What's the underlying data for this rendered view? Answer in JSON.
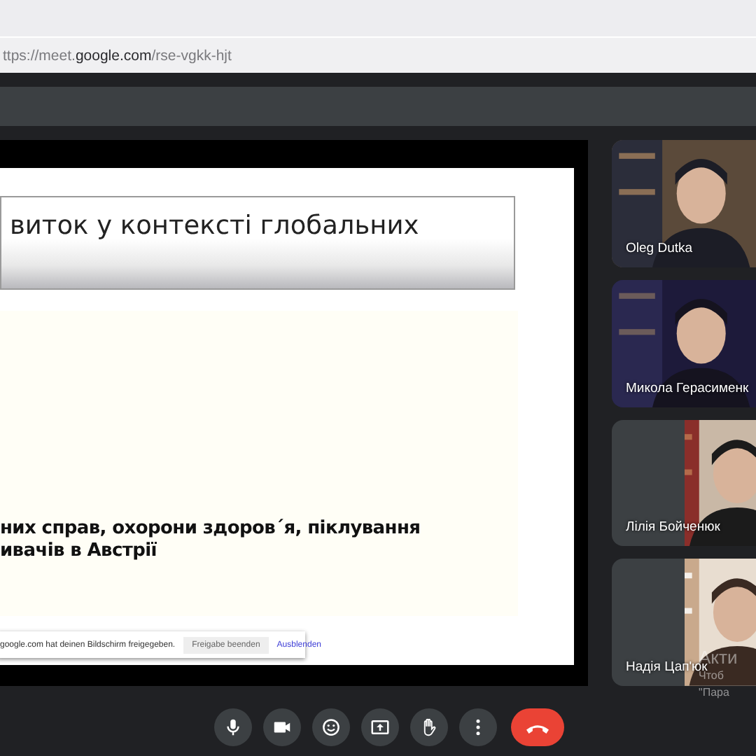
{
  "browser": {
    "url_prefix": "ttps://meet.",
    "url_domain": "google.com",
    "url_path": "/rse-vgkk-hjt"
  },
  "slide": {
    "title": "виток у контексті глобальних",
    "body_lines": [
      "них справ, охорони здоров´я, піклування",
      "ивачів в Австрії"
    ]
  },
  "share_notice": {
    "text": "google.com hat deinen Bildschirm freigegeben.",
    "stop_button": "Freigabe beenden",
    "hide_link": "Ausblenden"
  },
  "participants": [
    {
      "name": "Oleg Dutka",
      "kind": "full"
    },
    {
      "name": "Микола Герасименк",
      "kind": "full"
    },
    {
      "name": "Лілія Бойченюк",
      "kind": "partial"
    },
    {
      "name": "Надія Цап'юк",
      "kind": "partial"
    }
  ],
  "controls": [
    {
      "kind": "mic"
    },
    {
      "kind": "camera"
    },
    {
      "kind": "emoji"
    },
    {
      "kind": "present"
    },
    {
      "kind": "hand"
    },
    {
      "kind": "more"
    },
    {
      "kind": "hangup"
    }
  ],
  "os_notice": {
    "title": "Акти",
    "lines": [
      "Чтоб",
      "\"Пара"
    ]
  }
}
